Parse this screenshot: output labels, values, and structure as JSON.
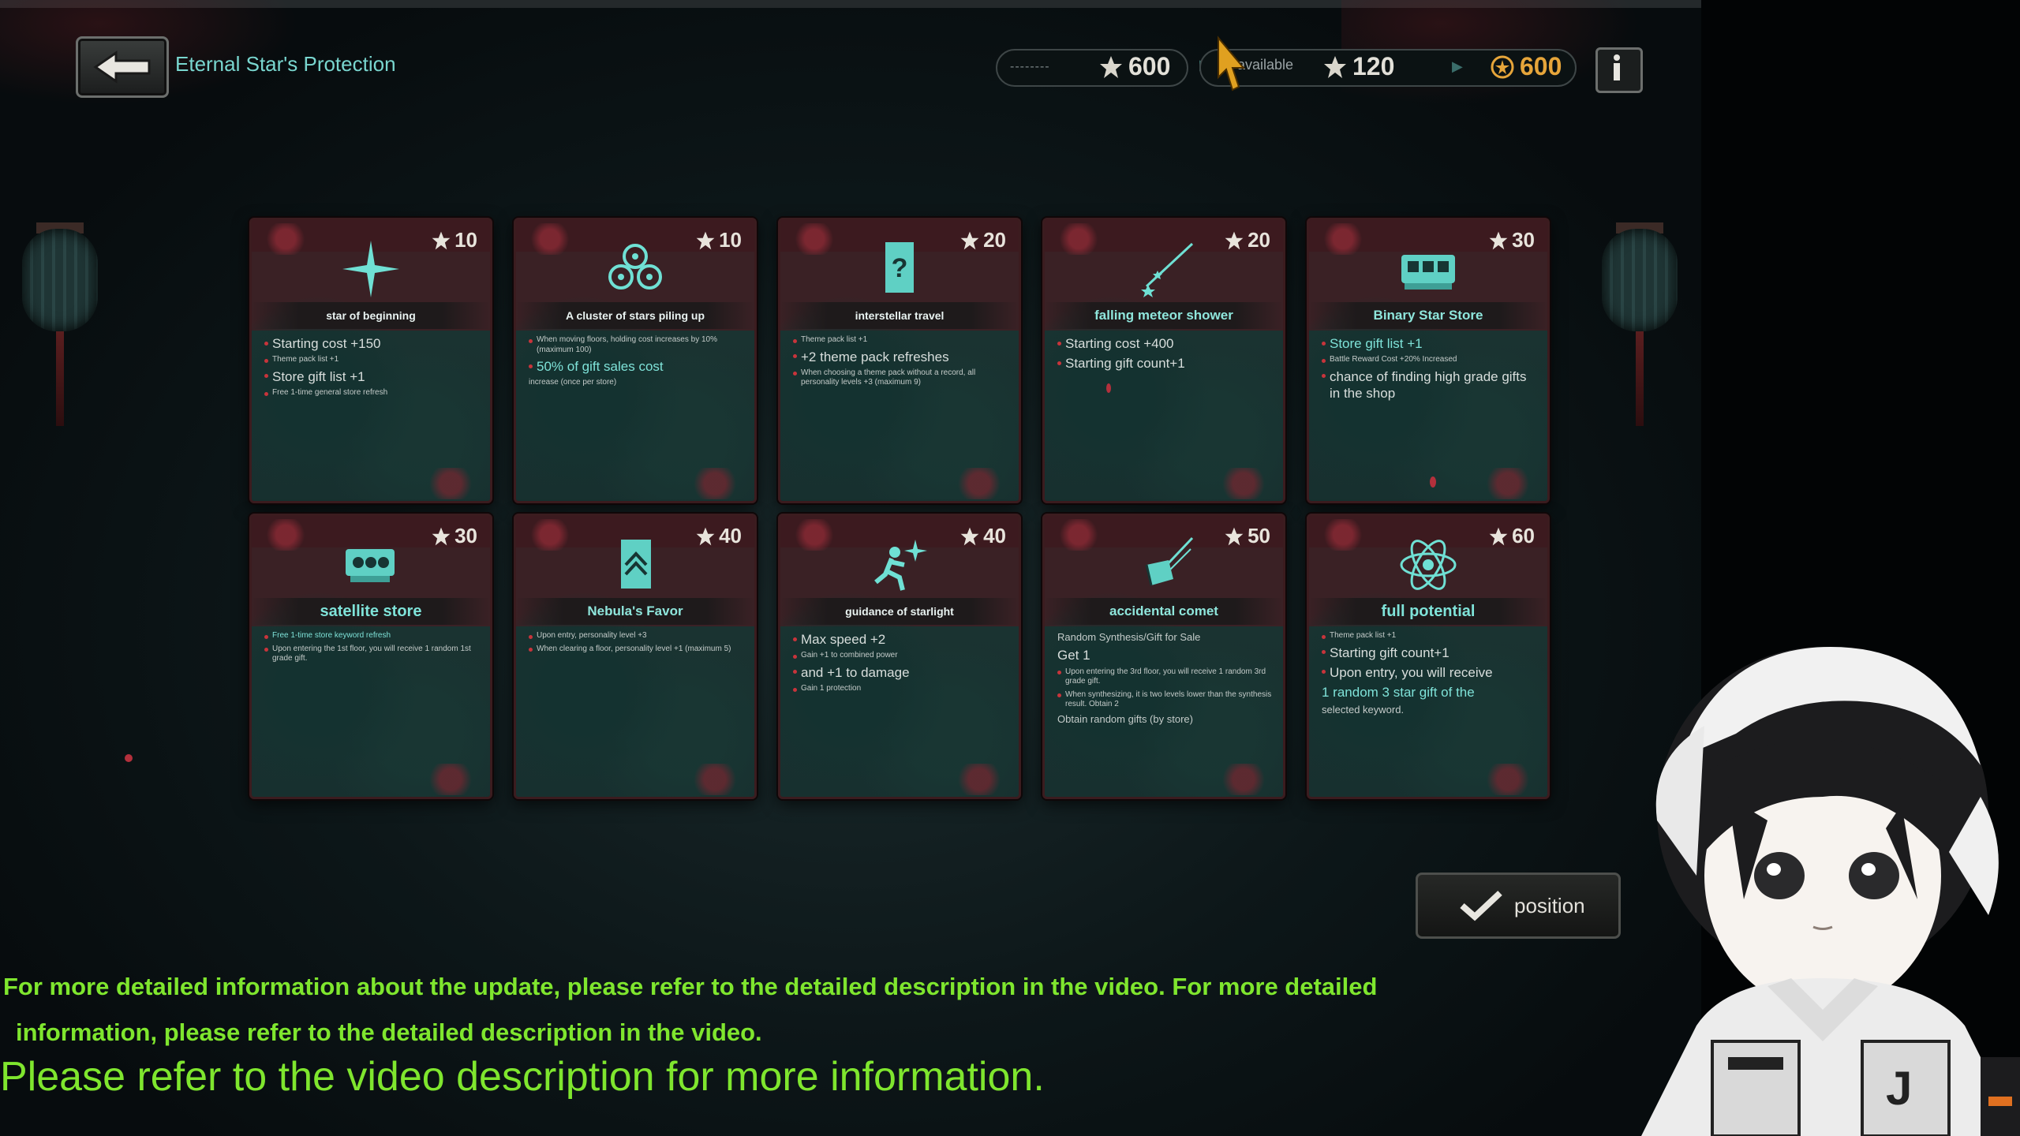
{
  "header": {
    "title": "Eternal Star's Protection",
    "back_icon": "arrow-left-icon",
    "left_placeholder": "--------",
    "starlight_total": "600",
    "available_label": "available",
    "starlight_available": "120",
    "coins": "600",
    "info_icon": "info-icon"
  },
  "cards": [
    {
      "cost": "10",
      "icon": "star-sparkle-icon",
      "name": "star of beginning",
      "lines": [
        {
          "t": "Starting cost +150",
          "s": "m",
          "b": true
        },
        {
          "t": "Theme pack list +1",
          "s": "s",
          "b": true
        },
        {
          "t": "Store gift list +1",
          "s": "m",
          "b": true
        },
        {
          "t": "Free 1-time general store refresh",
          "s": "s",
          "b": true
        }
      ]
    },
    {
      "cost": "10",
      "icon": "star-cluster-icon",
      "name": "A cluster of stars piling up",
      "lines": [
        {
          "t": "When moving floors, holding cost increases by 10% (maximum 100)",
          "s": "s",
          "b": true
        },
        {
          "t": "50% of gift sales cost",
          "s": "m",
          "b": true,
          "hl": true
        },
        {
          "t": "increase (once per store)",
          "s": "s",
          "b": false
        }
      ]
    },
    {
      "cost": "20",
      "icon": "mystery-card-icon",
      "name": "interstellar travel",
      "lines": [
        {
          "t": "Theme pack list +1",
          "s": "s",
          "b": true
        },
        {
          "t": "+2 theme pack refreshes",
          "s": "m",
          "b": true
        },
        {
          "t": "When choosing a theme pack without a record, all personality levels +3 (maximum 9)",
          "s": "s",
          "b": true
        }
      ]
    },
    {
      "cost": "20",
      "icon": "meteor-shower-icon",
      "name": "falling meteor shower",
      "lines": [
        {
          "t": "Starting cost +400",
          "s": "m",
          "b": true
        },
        {
          "t": "Starting gift count+1",
          "s": "m",
          "b": true
        }
      ]
    },
    {
      "cost": "30",
      "icon": "binary-star-store-icon",
      "name": "Binary Star Store",
      "lines": [
        {
          "t": "Store gift list +1",
          "s": "m",
          "b": true,
          "hl": true
        },
        {
          "t": "Battle Reward Cost +20% Increased",
          "s": "s",
          "b": true
        },
        {
          "t": "chance of finding high grade gifts in the shop",
          "s": "m",
          "b": true
        }
      ]
    },
    {
      "cost": "30",
      "icon": "satellite-store-icon",
      "name": "satellite store",
      "lines": [
        {
          "t": "Free 1-time store keyword refresh",
          "s": "s",
          "b": true,
          "hl": true
        },
        {
          "t": "Upon entering the 1st floor, you will receive 1 random 1st grade gift.",
          "s": "s",
          "b": true
        }
      ]
    },
    {
      "cost": "40",
      "icon": "nebula-banner-icon",
      "name": "Nebula's Favor",
      "lines": [
        {
          "t": "Upon entry, personality level +3",
          "s": "s",
          "b": true
        },
        {
          "t": "When clearing a floor, personality level +1 (maximum 5)",
          "s": "s",
          "b": true
        }
      ]
    },
    {
      "cost": "40",
      "icon": "running-starlight-icon",
      "name": "guidance of starlight",
      "lines": [
        {
          "t": "Max speed +2",
          "s": "m",
          "b": true
        },
        {
          "t": "Gain +1 to combined power",
          "s": "s",
          "b": true
        },
        {
          "t": "and +1 to damage",
          "s": "m",
          "b": true
        },
        {
          "t": "Gain 1 protection",
          "s": "s",
          "b": true
        }
      ]
    },
    {
      "cost": "50",
      "icon": "comet-box-icon",
      "name": "accidental comet",
      "lines": [
        {
          "t": "Random Synthesis/Gift for Sale",
          "s": "ml",
          "b": false
        },
        {
          "t": "Get 1",
          "s": "m",
          "b": false
        },
        {
          "t": "Upon entering the 3rd floor, you will receive 1 random 3rd grade gift.",
          "s": "s",
          "b": true
        },
        {
          "t": "When synthesizing, it is two levels lower than the synthesis result. Obtain 2",
          "s": "s",
          "b": true
        },
        {
          "t": "Obtain random gifts (by store)",
          "s": "ml",
          "b": false
        }
      ]
    },
    {
      "cost": "60",
      "icon": "atom-potential-icon",
      "name": "full potential",
      "lines": [
        {
          "t": "Theme pack list +1",
          "s": "s",
          "b": true
        },
        {
          "t": "Starting gift count+1",
          "s": "m",
          "b": true
        },
        {
          "t": "Upon entry, you will receive",
          "s": "m",
          "b": true
        },
        {
          "t": "1 random 3 star gift of the",
          "s": "m",
          "b": false,
          "hl": true
        },
        {
          "t": "selected keyword.",
          "s": "ml",
          "b": false
        }
      ]
    }
  ],
  "position_button": {
    "label": "position",
    "icon": "checkmark-icon"
  },
  "subtitles": {
    "line1": "For more detailed information about the update, please refer to the detailed description in the video. For more detailed",
    "line2": "information, please refer to the detailed description in the video.",
    "line3": "Please refer to the video description for more information."
  },
  "colors": {
    "accent": "#79d6cf",
    "subtitle": "#7fe62e",
    "coin": "#e6a53a",
    "blossom": "#8b2a35"
  }
}
